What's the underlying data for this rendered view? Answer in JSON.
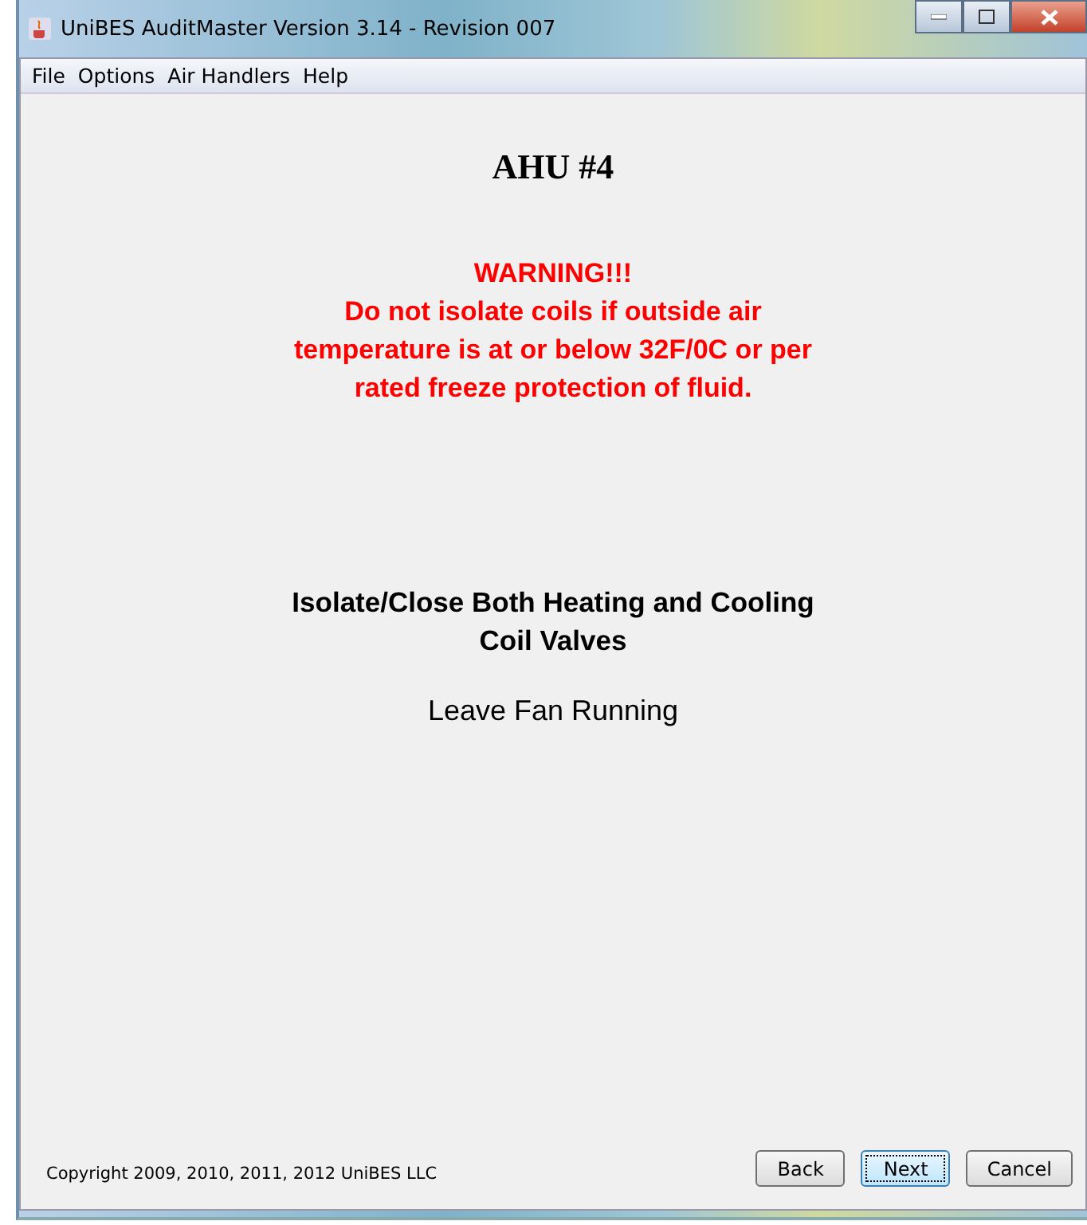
{
  "window": {
    "title": "UniBES AuditMaster Version 3.14 - Revision 007"
  },
  "menu": [
    "File",
    "Options",
    "Air Handlers",
    "Help"
  ],
  "heading": "AHU #4",
  "warning": [
    "WARNING!!!",
    "Do not isolate coils if outside air",
    "temperature is at or below 32F/0C or per",
    "rated freeze protection of fluid."
  ],
  "instruction": [
    "Isolate/Close Both Heating and Cooling",
    "Coil Valves"
  ],
  "note": "Leave Fan Running",
  "copyright": "Copyright 2009, 2010, 2011, 2012 UniBES LLC",
  "buttons": [
    {
      "label": "Back",
      "default": false
    },
    {
      "label": "Next",
      "default": true
    },
    {
      "label": "Cancel",
      "default": false
    }
  ]
}
